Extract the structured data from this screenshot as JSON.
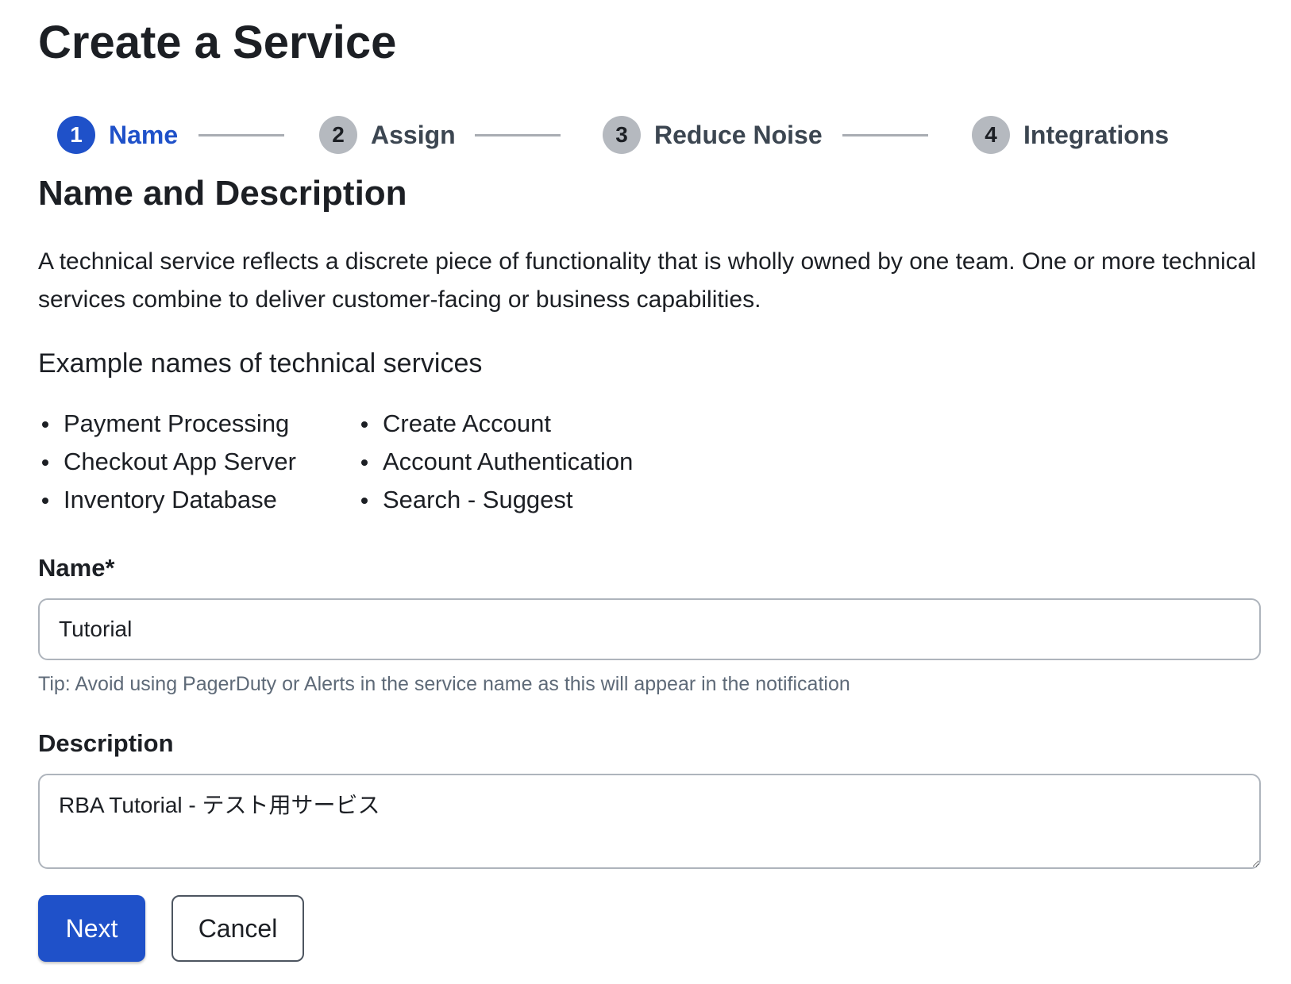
{
  "page": {
    "title": "Create a Service"
  },
  "stepper": {
    "steps": [
      {
        "number": "1",
        "label": "Name",
        "active": true
      },
      {
        "number": "2",
        "label": "Assign",
        "active": false
      },
      {
        "number": "3",
        "label": "Reduce Noise",
        "active": false
      },
      {
        "number": "4",
        "label": "Integrations",
        "active": false
      }
    ]
  },
  "section": {
    "title": "Name and Description",
    "intro": "A technical service reflects a discrete piece of functionality that is wholly owned by one team. One or more technical services combine to deliver customer-facing or business capabilities.",
    "examples_heading": "Example names of technical services",
    "examples_col1": [
      "Payment Processing",
      "Checkout App Server",
      "Inventory Database"
    ],
    "examples_col2": [
      "Create Account",
      "Account Authentication",
      "Search - Suggest"
    ]
  },
  "form": {
    "name_label": "Name*",
    "name_value": "Tutorial",
    "name_tip": "Tip: Avoid using PagerDuty or Alerts in the service name as this will appear in the notification",
    "description_label": "Description",
    "description_value": "RBA Tutorial - テスト用サービス"
  },
  "actions": {
    "next_label": "Next",
    "cancel_label": "Cancel"
  },
  "colors": {
    "primary": "#1f51c9",
    "inactive_step": "#b5b9bf",
    "text": "#1c1f24",
    "muted": "#5e6a78"
  }
}
